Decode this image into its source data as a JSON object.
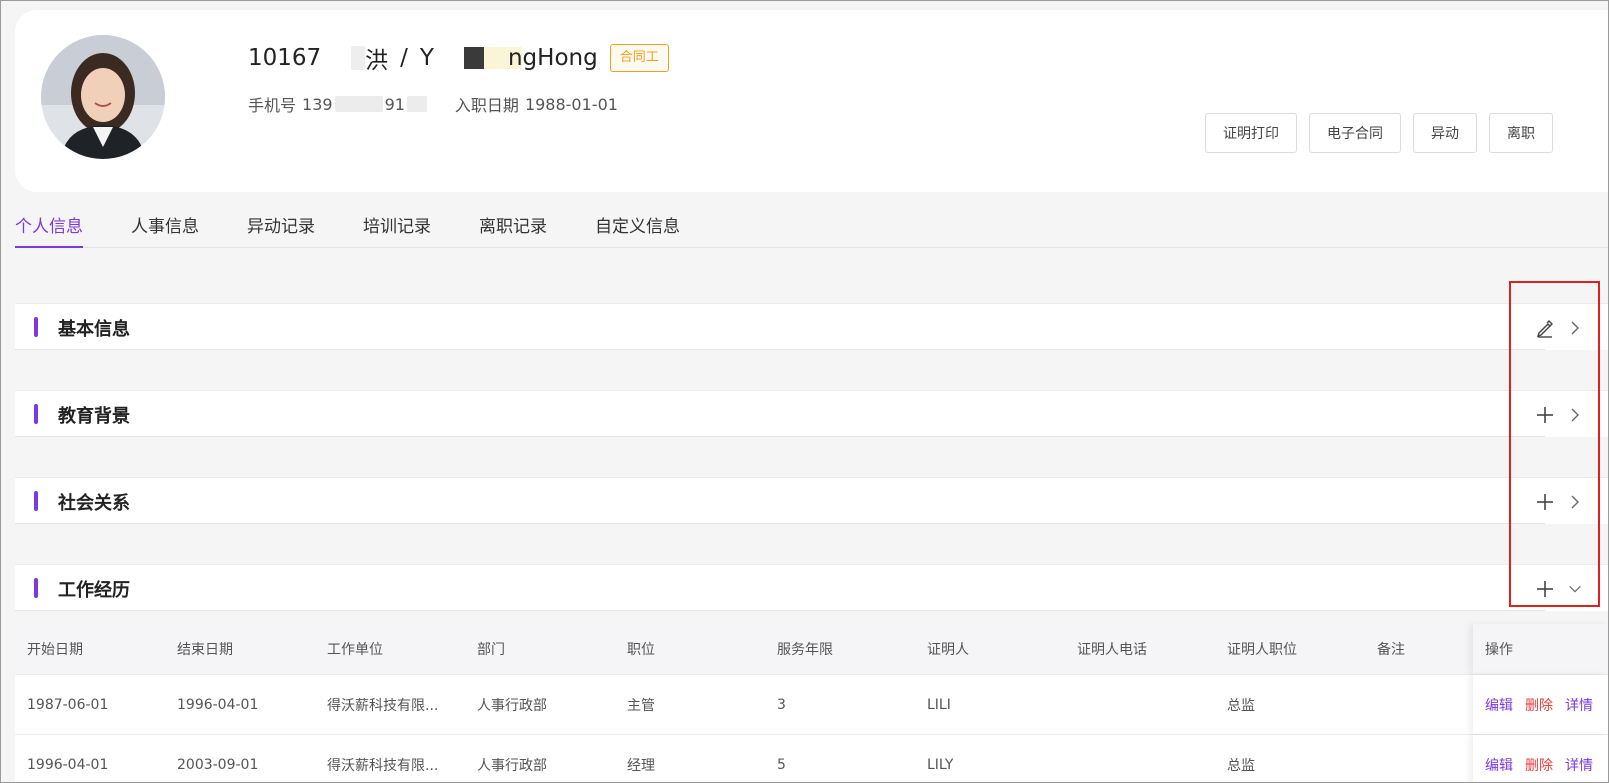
{
  "employee": {
    "id": "10167",
    "name_cn_tail": "洪",
    "separator": "/",
    "name_en_start": "Y",
    "name_en_tail": "ngHong",
    "type_tag": "合同工",
    "phone_label": "手机号",
    "phone_start": "139",
    "phone_end": "91",
    "hire_label": "入职日期",
    "hire_date": "1988-01-01"
  },
  "header_actions": [
    "证明打印",
    "电子合同",
    "异动",
    "离职"
  ],
  "tabs": [
    "个人信息",
    "人事信息",
    "异动记录",
    "培训记录",
    "离职记录",
    "自定义信息"
  ],
  "active_tab": 0,
  "sections": [
    {
      "title": "基本信息",
      "action_icon": "edit-icon",
      "expand_icon": "chevron-right-icon"
    },
    {
      "title": "教育背景",
      "action_icon": "plus-icon",
      "expand_icon": "chevron-right-icon"
    },
    {
      "title": "社会关系",
      "action_icon": "plus-icon",
      "expand_icon": "chevron-right-icon"
    },
    {
      "title": "工作经历",
      "action_icon": "plus-icon",
      "expand_icon": "chevron-down-icon"
    }
  ],
  "work_table": {
    "columns": [
      "开始日期",
      "结束日期",
      "工作单位",
      "部门",
      "职位",
      "服务年限",
      "证明人",
      "证明人电话",
      "证明人职位",
      "备注",
      "操作"
    ],
    "rows": [
      [
        "1987-06-01",
        "1996-04-01",
        "得沃薪科技有限...",
        "人事行政部",
        "主管",
        "3",
        "LILI",
        "",
        "总监",
        ""
      ],
      [
        "1996-04-01",
        "2003-09-01",
        "得沃薪科技有限...",
        "人事行政部",
        "经理",
        "5",
        "LILY",
        "",
        "总监",
        ""
      ]
    ],
    "row_actions": {
      "edit": "编辑",
      "delete": "删除",
      "detail": "详情"
    }
  },
  "colors": {
    "accent": "#7b3ae0",
    "tag": "#f0a020",
    "danger": "#e84040",
    "highlight": "#e02020"
  }
}
